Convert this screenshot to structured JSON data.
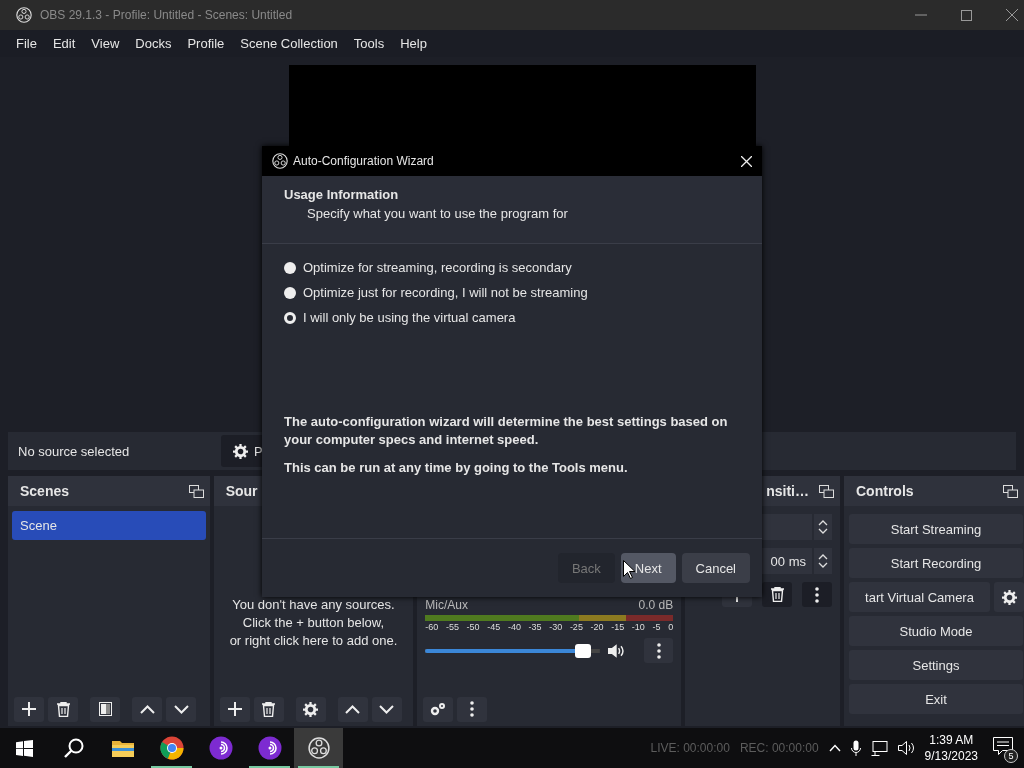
{
  "window": {
    "title": "OBS 29.1.3 - Profile: Untitled - Scenes: Untitled"
  },
  "menu": [
    "File",
    "Edit",
    "View",
    "Docks",
    "Profile",
    "Scene Collection",
    "Tools",
    "Help"
  ],
  "context_bar": {
    "status": "No source selected",
    "button": "P"
  },
  "scenes": {
    "title": "Scenes",
    "items": [
      {
        "label": "Scene",
        "selected": true
      }
    ]
  },
  "sources": {
    "title": "Sour",
    "empty_message": [
      "You don't have any sources.",
      "Click the + button below,",
      "or right click here to add one."
    ]
  },
  "mixer": {
    "channels": [
      {
        "name": "Mic/Aux",
        "reading": "0.0 dB",
        "level": 0.95,
        "ticks": [
          "-60",
          "-55",
          "-50",
          "-45",
          "-40",
          "-35",
          "-30",
          "-25",
          "-20",
          "-15",
          "-10",
          "-5",
          "0"
        ]
      }
    ]
  },
  "transitions": {
    "title": "nsiti…",
    "duration": "00 ms"
  },
  "controls": {
    "title": "Controls",
    "buttons": [
      {
        "kind": "wide",
        "label": "Start Streaming"
      },
      {
        "kind": "wide",
        "label": "Start Recording"
      },
      {
        "kind": "gear",
        "label": "tart Virtual Camera"
      },
      {
        "kind": "wide",
        "label": "Studio Mode"
      },
      {
        "kind": "wide",
        "label": "Settings"
      },
      {
        "kind": "wide",
        "label": "Exit"
      }
    ]
  },
  "dialog": {
    "title": "Auto-Configuration Wizard",
    "heading": "Usage Information",
    "subheading": "Specify what you want to use the program for",
    "options": [
      {
        "label": "Optimize for streaming, recording is secondary",
        "selected": false
      },
      {
        "label": "Optimize just for recording, I will not be streaming",
        "selected": false
      },
      {
        "label": "I will only be using the virtual camera",
        "selected": true
      }
    ],
    "notes": [
      "The auto-configuration wizard will determine the best settings based on your computer specs and internet speed.",
      "This can be run at any time by going to the Tools menu."
    ],
    "buttons": [
      {
        "label": "Back",
        "disabled": true
      },
      {
        "label": "Next",
        "disabled": false
      },
      {
        "label": "Cancel",
        "disabled": false
      }
    ]
  },
  "taskbar": {
    "apps": [
      {
        "kind": "folder",
        "running": false,
        "active": false
      },
      {
        "kind": "browser",
        "running": true,
        "active": false
      },
      {
        "kind": "purple",
        "running": false,
        "active": false
      },
      {
        "kind": "purple",
        "running": true,
        "active": false
      },
      {
        "kind": "obs",
        "running": true,
        "active": true
      }
    ],
    "status": [
      "LIVE: 00:00:00",
      "REC: 00:00:00"
    ],
    "time": "1:39 AM",
    "date": "9/13/2023",
    "notifications": "5"
  }
}
